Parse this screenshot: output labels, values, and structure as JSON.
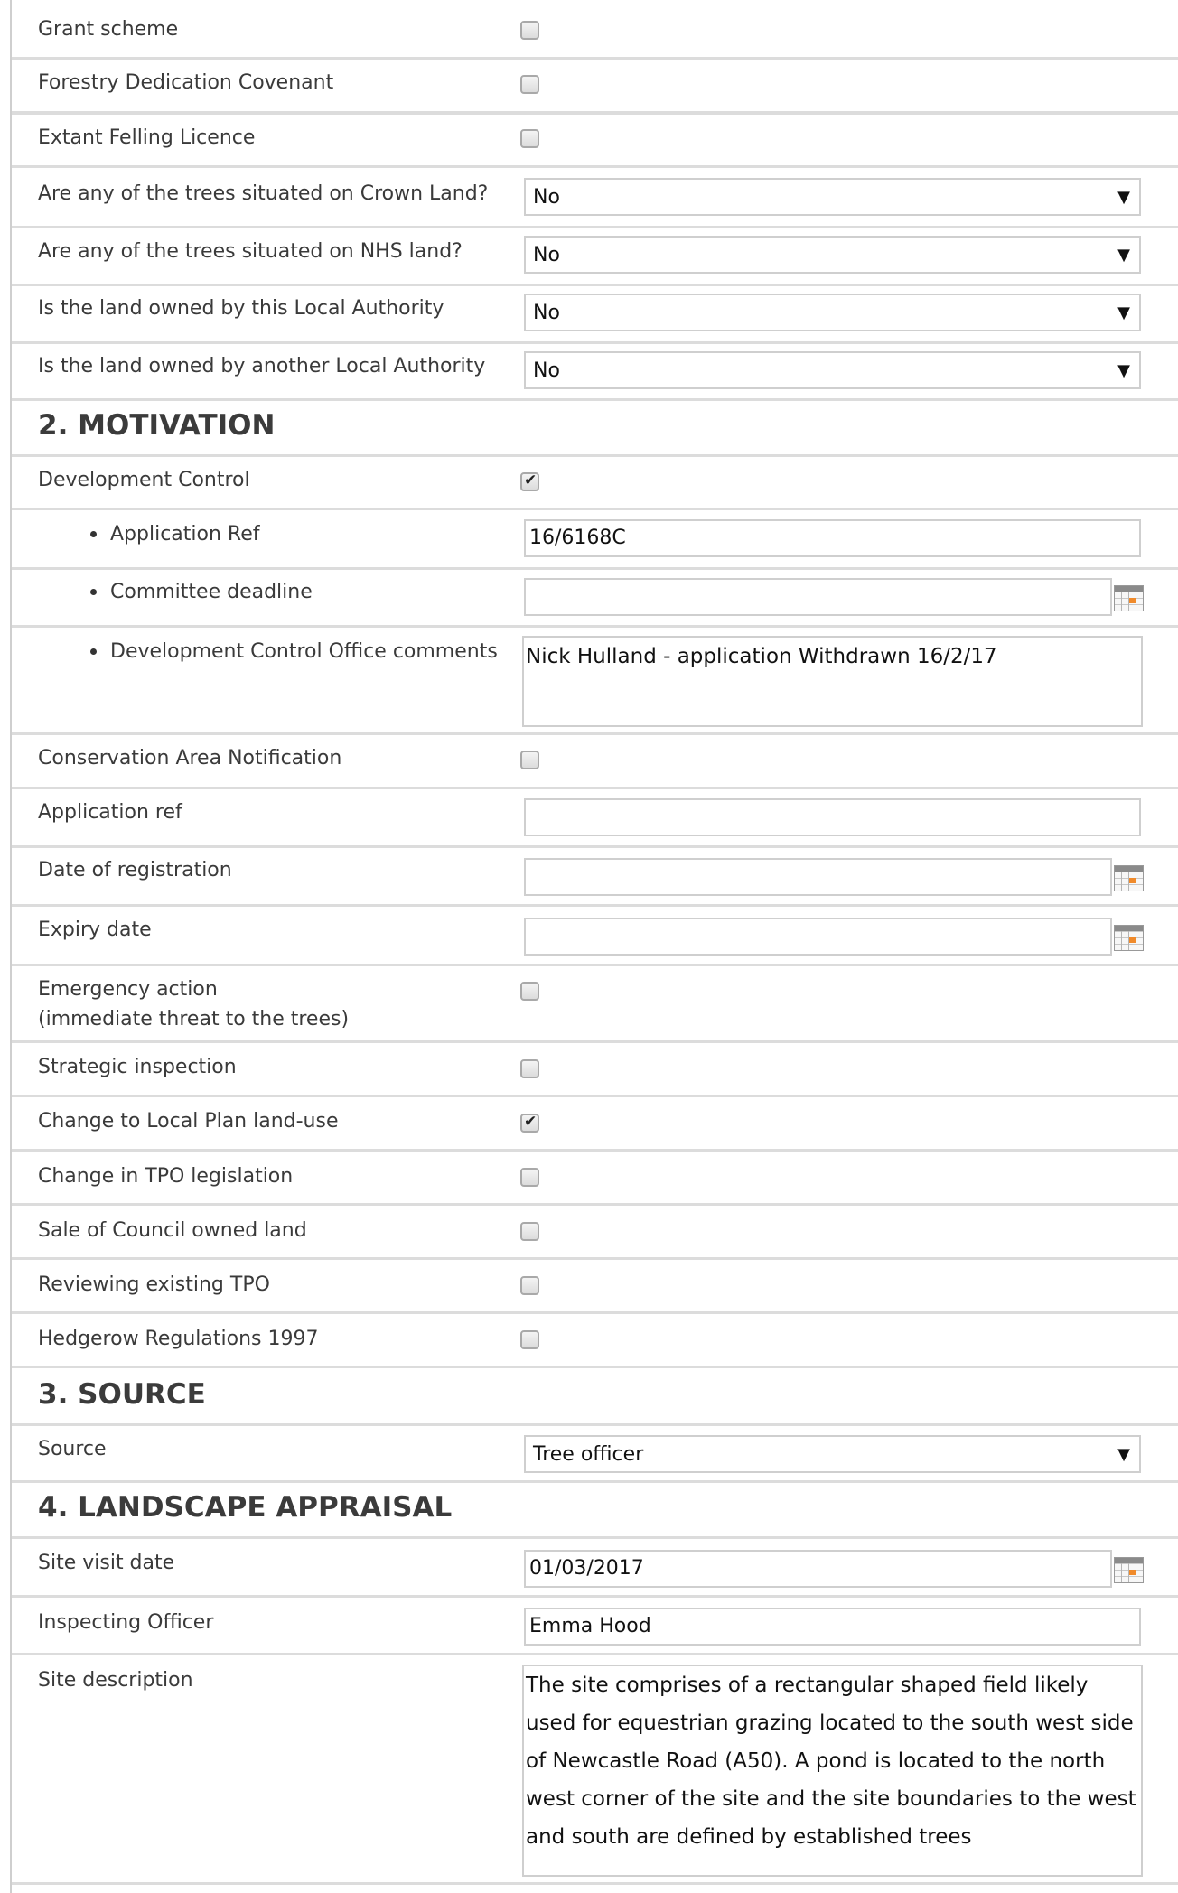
{
  "rows": {
    "grant_scheme": {
      "label": "Grant scheme",
      "checked": false
    },
    "forestry_dedication": {
      "label": "Forestry Dedication Covenant",
      "checked": false
    },
    "extant_felling": {
      "label": "Extant Felling Licence",
      "checked": false
    },
    "crown_land": {
      "label": "Are any of the trees situated on Crown Land?",
      "value": "No"
    },
    "nhs_land": {
      "label": "Are any of the trees situated on NHS land?",
      "value": "No"
    },
    "this_la": {
      "label": "Is the land owned by this Local Authority",
      "value": "No"
    },
    "another_la": {
      "label": "Is the land owned by another Local Authority",
      "value": "No"
    }
  },
  "motivation": {
    "title": "2. MOTIVATION",
    "development_control": {
      "label": "Development Control",
      "checked": true
    },
    "application_ref": {
      "label": "Application Ref",
      "value": "16/6168C"
    },
    "committee_deadline": {
      "label": " Committee deadline",
      "value": ""
    },
    "dc_comments": {
      "label": "Development Control Office comments",
      "value": "Nick Hulland  - application Withdrawn 16/2/17"
    },
    "conservation_area": {
      "label": "Conservation Area Notification",
      "checked": false
    },
    "application_ref2": {
      "label": "Application ref",
      "value": ""
    },
    "date_registration": {
      "label": "Date of registration",
      "value": ""
    },
    "expiry_date": {
      "label": "Expiry date",
      "value": ""
    },
    "emergency_action": {
      "label": "Emergency action",
      "label2": "(immediate threat to the trees)",
      "checked": false
    },
    "strategic_inspection": {
      "label": "Strategic inspection",
      "checked": false
    },
    "local_plan": {
      "label": "Change to Local Plan land-use",
      "checked": true
    },
    "tpo_legislation": {
      "label": "Change in TPO legislation",
      "checked": false
    },
    "council_land": {
      "label": "Sale of Council owned land",
      "checked": false
    },
    "reviewing_tpo": {
      "label": "Reviewing existing TPO",
      "checked": false
    },
    "hedgerow": {
      "label": "Hedgerow Regulations 1997",
      "checked": false
    }
  },
  "source": {
    "title": "3. SOURCE",
    "label": "Source",
    "value": "Tree officer"
  },
  "landscape": {
    "title": "4. LANDSCAPE APPRAISAL",
    "site_visit": {
      "label": "Site visit date",
      "value": "01/03/2017"
    },
    "inspecting_officer": {
      "label": "Inspecting Officer",
      "value": "Emma Hood"
    },
    "site_description": {
      "label": "Site description",
      "value": "The site comprises of a rectangular shaped field likely used for equestrian grazing located to the south west side of Newcastle Road (A50).  A pond is located to the north west corner of the site and the site boundaries to the west and south are defined by established trees"
    }
  },
  "icons": {
    "dropdown": "caret-down-icon",
    "calendar": "calendar-icon",
    "checkbox": "checkbox"
  }
}
